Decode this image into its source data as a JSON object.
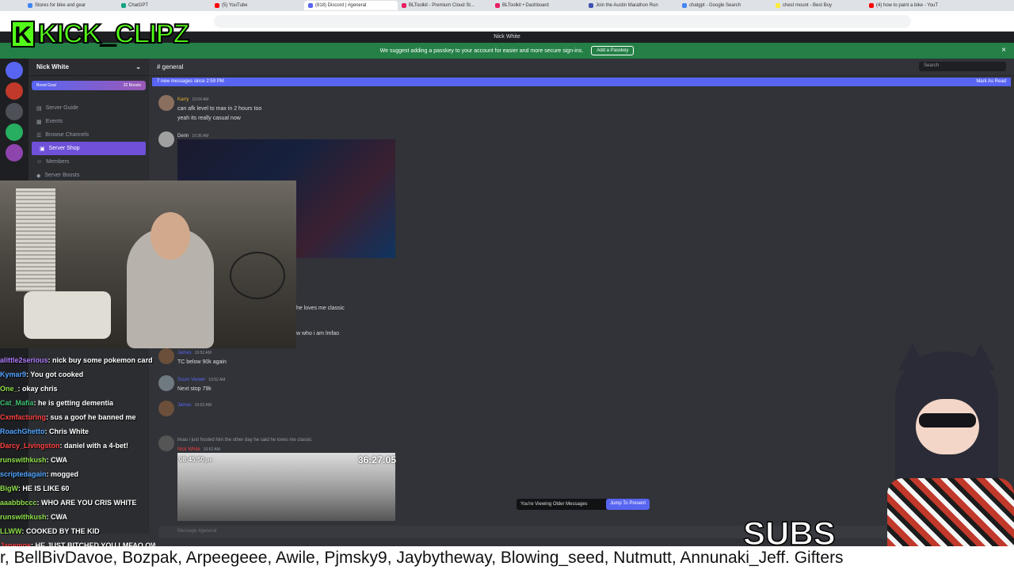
{
  "browser": {
    "tabs": [
      {
        "title": "Stores for bike and gear",
        "color": "#4285f4"
      },
      {
        "title": "ChatGPT",
        "color": "#10a37f"
      },
      {
        "title": "(5) YouTube",
        "color": "#ff0000"
      },
      {
        "title": "(818) Discord | #general",
        "color": "#5865f2"
      },
      {
        "title": "BLToolkit - Premium Cloud St...",
        "color": "#e91e63"
      },
      {
        "title": "BLToolkit • Dashboard",
        "color": "#e91e63"
      },
      {
        "title": "Join the Austin Marathon Run",
        "color": "#3f51b5"
      },
      {
        "title": "chatgpt - Google Search",
        "color": "#4285f4"
      },
      {
        "title": "chest mount - Best Buy",
        "color": "#ffeb3b"
      },
      {
        "title": "(4) how to paint a bike - YouT",
        "color": "#ff0000"
      }
    ]
  },
  "app": {
    "window_title": "Nick White"
  },
  "banner": {
    "text": "We suggest adding a passkey to your account for easier and more secure sign-ins.",
    "button": "Add a Passkey"
  },
  "sidebar": {
    "guild_name": "Nick White",
    "boost_goal": "Boost Goal",
    "boost_count": "32 Boosts",
    "items": [
      {
        "label": "Server Guide"
      },
      {
        "label": "Events"
      },
      {
        "label": "Browse Channels"
      },
      {
        "label": "Server Shop"
      },
      {
        "label": "Members"
      },
      {
        "label": "Server Boosts"
      }
    ]
  },
  "chat": {
    "channel": "general",
    "search_placeholder": "Search",
    "new_messages": "7 new messages since 2:59 PM",
    "mark_read": "Mark As Read",
    "messages": [
      {
        "name": "Karry",
        "time": "10:04 AM",
        "lines": [
          "can afk level to max in 2 hours too",
          "yeah its really casual now"
        ]
      },
      {
        "name": "Derin",
        "time": "10:36 AM",
        "lines": []
      },
      {
        "name": "",
        "time": "",
        "lines": [
          "he loves me classic"
        ]
      },
      {
        "name": "",
        "time": "",
        "lines": [
          "w who i am lmfao"
        ]
      },
      {
        "name": "James",
        "time": "10:52 AM",
        "lines": [
          "TC below 90k again"
        ]
      },
      {
        "name": "Scum Viewer",
        "time": "10:52 AM",
        "lines": [
          "Next stop 79k"
        ]
      },
      {
        "name": "James",
        "time": "10:52 AM",
        "lines": []
      },
      {
        "name": "Nick White",
        "time": "10:52 AM",
        "lines": [
          "lmao i just hosted him the other day he said he loves me classic"
        ]
      }
    ],
    "video_time_left": "08:45:50",
    "video_time_left_suffix": "pm",
    "video_time_right": "36:27:05",
    "older_notice": "You're Viewing Older Messages",
    "jump_button": "Jump To Present",
    "composer_placeholder": "Message #general"
  },
  "overlay": {
    "logo_text": "KICK_CLIPZ",
    "logo_letter": "K",
    "subs_label": "SUBS",
    "chat_lines": [
      {
        "user": "alittle2serious",
        "text": ": nick buy some pokemon card",
        "color": "#b07cff"
      },
      {
        "user": "Kymar9",
        "text": ": You got cooked",
        "color": "#4fa3ff"
      },
      {
        "user": "One_",
        "text": ": okay chris",
        "color": "#8ee04a"
      },
      {
        "user": "Cat_Mafia",
        "text": ": he is getting dementia",
        "color": "#40c070"
      },
      {
        "user": "Cxmfacturing",
        "text": ": sus a goof he banned me",
        "color": "#ff4040"
      },
      {
        "user": "RoachGhetto",
        "text": ": Chris White",
        "color": "#4fa3ff"
      },
      {
        "user": "Darcy_Livingston",
        "text": ": daniel with a 4-bet!",
        "color": "#ff4040"
      },
      {
        "user": "runswithkush",
        "text": ": CWA",
        "color": "#8ee04a"
      },
      {
        "user": "scriptedagain",
        "text": ": mogged",
        "color": "#4fa3ff"
      },
      {
        "user": "BigW",
        "text": ": HE IS LIKE 60",
        "color": "#8ee04a"
      },
      {
        "user": "aaabbbccc",
        "text": ": WHO ARE YOU CRIS WHITE",
        "color": "#8ee04a"
      },
      {
        "user": "runswithkush",
        "text": ": CWA",
        "color": "#8ee04a"
      },
      {
        "user": "LLWW",
        "text": ": COOKED BY THE KID",
        "color": "#8ee04a"
      },
      {
        "user": "Janemoe",
        "text": ": HE JUST BITCHED YOU LMFAO OWNED",
        "color": "#ff4040"
      }
    ],
    "ticker": "r, BellBivDavoe, Bozpak, Arpeegeee, Awile, Pjmsky9, Jaybytheway, Blowing_seed, Nutmutt, Annunaki_Jeff. Gifters"
  }
}
